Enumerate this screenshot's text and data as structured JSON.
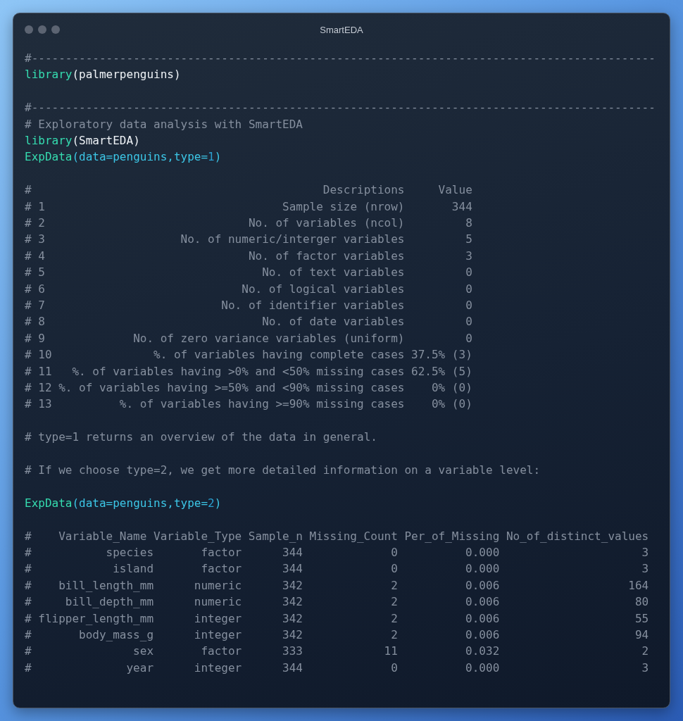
{
  "window": {
    "title": "SmartEDA"
  },
  "lines": [
    {
      "kind": "comment",
      "text": "#--------------------------------------------------------------------------------------------"
    },
    {
      "kind": "code",
      "tokens": [
        {
          "kind": "fn",
          "text": "library"
        },
        {
          "kind": "plain",
          "text": "(palmerpenguins)"
        }
      ]
    },
    {
      "kind": "blank"
    },
    {
      "kind": "comment",
      "text": "#--------------------------------------------------------------------------------------------"
    },
    {
      "kind": "comment",
      "text": "# Exploratory data analysis with SmartEDA"
    },
    {
      "kind": "code",
      "tokens": [
        {
          "kind": "fn",
          "text": "library"
        },
        {
          "kind": "plain",
          "text": "(SmartEDA)"
        }
      ]
    },
    {
      "kind": "code",
      "tokens": [
        {
          "kind": "fn",
          "text": "ExpData"
        },
        {
          "kind": "arg",
          "text": "(data=penguins,type="
        },
        {
          "kind": "num",
          "text": "1"
        },
        {
          "kind": "arg",
          "text": ")"
        }
      ]
    },
    {
      "kind": "blank"
    },
    {
      "kind": "summary_table",
      "columns": [
        "#",
        "Descriptions",
        "Value"
      ],
      "rows": [
        {
          "index": "# 1",
          "description": "Sample size (nrow)",
          "value": "344"
        },
        {
          "index": "# 2",
          "description": "No. of variables (ncol)",
          "value": "8"
        },
        {
          "index": "# 3",
          "description": "No. of numeric/interger variables",
          "value": "5"
        },
        {
          "index": "# 4",
          "description": "No. of factor variables",
          "value": "3"
        },
        {
          "index": "# 5",
          "description": "No. of text variables",
          "value": "0"
        },
        {
          "index": "# 6",
          "description": "No. of logical variables",
          "value": "0"
        },
        {
          "index": "# 7",
          "description": "No. of identifier variables",
          "value": "0"
        },
        {
          "index": "# 8",
          "description": "No. of date variables",
          "value": "0"
        },
        {
          "index": "# 9",
          "description": "No. of zero variance variables (uniform)",
          "value": "0"
        },
        {
          "index": "# 10",
          "description": "%. of variables having complete cases",
          "value": "37.5% (3)"
        },
        {
          "index": "# 11",
          "description": "%. of variables having >0% and <50% missing cases",
          "value": "62.5% (5)"
        },
        {
          "index": "# 12",
          "description": "%. of variables having >=50% and <90% missing cases",
          "value": "0% (0)"
        },
        {
          "index": "# 13",
          "description": "%. of variables having >=90% missing cases",
          "value": "0% (0)"
        }
      ]
    },
    {
      "kind": "blank"
    },
    {
      "kind": "comment",
      "text": "# type=1 returns an overview of the data in general."
    },
    {
      "kind": "blank"
    },
    {
      "kind": "comment",
      "text": "# If we choose type=2, we get more detailed information on a variable level:"
    },
    {
      "kind": "blank"
    },
    {
      "kind": "code",
      "tokens": [
        {
          "kind": "fn",
          "text": "ExpData"
        },
        {
          "kind": "arg",
          "text": "(data=penguins,type="
        },
        {
          "kind": "num",
          "text": "2"
        },
        {
          "kind": "arg",
          "text": ")"
        }
      ]
    },
    {
      "kind": "blank"
    },
    {
      "kind": "variable_table",
      "columns": [
        "#",
        "Variable_Name",
        "Variable_Type",
        "Sample_n",
        "Missing_Count",
        "Per_of_Missing",
        "No_of_distinct_values"
      ],
      "rows": [
        [
          "#",
          "species",
          "factor",
          "344",
          "0",
          "0.000",
          "3"
        ],
        [
          "#",
          "island",
          "factor",
          "344",
          "0",
          "0.000",
          "3"
        ],
        [
          "#",
          "bill_length_mm",
          "numeric",
          "342",
          "2",
          "0.006",
          "164"
        ],
        [
          "#",
          "bill_depth_mm",
          "numeric",
          "342",
          "2",
          "0.006",
          "80"
        ],
        [
          "#",
          "flipper_length_mm",
          "integer",
          "342",
          "2",
          "0.006",
          "55"
        ],
        [
          "#",
          "body_mass_g",
          "integer",
          "342",
          "2",
          "0.006",
          "94"
        ],
        [
          "#",
          "sex",
          "factor",
          "333",
          "11",
          "0.032",
          "2"
        ],
        [
          "#",
          "year",
          "integer",
          "344",
          "0",
          "0.000",
          "3"
        ]
      ]
    }
  ]
}
